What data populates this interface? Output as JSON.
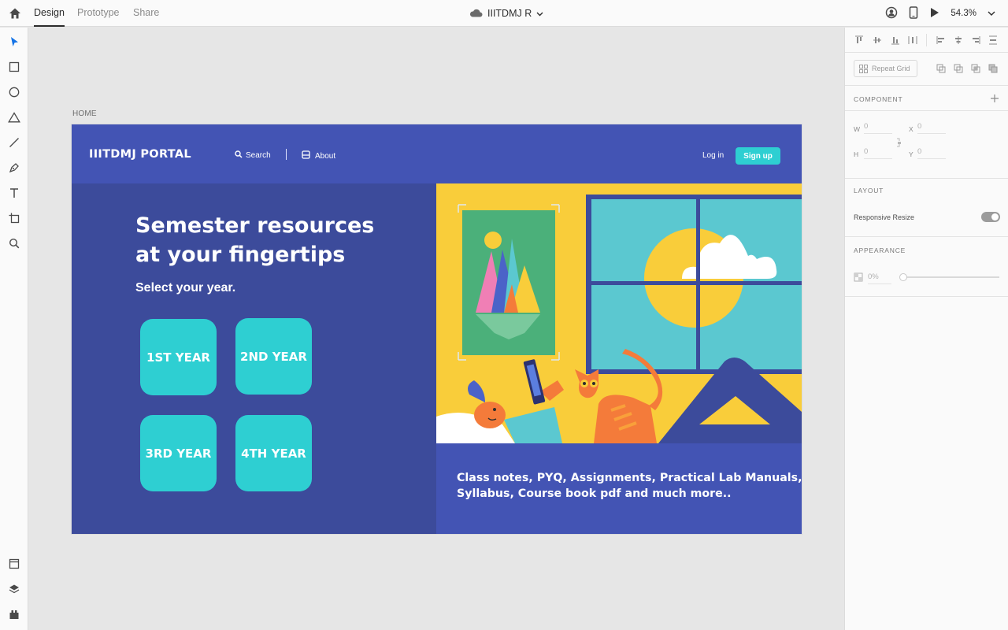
{
  "topbar": {
    "tabs": [
      "Design",
      "Prototype",
      "Share"
    ],
    "doc_title": "IIITDMJ R",
    "zoom": "54.3%"
  },
  "artboard": {
    "label": "HOME",
    "nav": {
      "brand": "IIITDMJ PORTAL",
      "search": "Search",
      "about": "About",
      "login": "Log in",
      "signup": "Sign up"
    },
    "hero": {
      "title_line1": "Semester resources",
      "title_line2": "at your fingertips",
      "subtitle": "Select your year."
    },
    "years": [
      "1ST YEAR",
      "2ND YEAR",
      "3RD YEAR",
      "4TH YEAR"
    ],
    "tagline_line1": "Class notes, PYQ, Assignments, Practical Lab Manuals,",
    "tagline_line2": "Syllabus, Course book pdf and much more.."
  },
  "panel": {
    "repeat_grid": "Repeat Grid",
    "component_label": "COMPONENT",
    "w_label": "W",
    "w_value": "0",
    "h_label": "H",
    "h_value": "0",
    "x_label": "X",
    "x_value": "0",
    "y_label": "Y",
    "y_value": "0",
    "layout_label": "LAYOUT",
    "responsive_resize": "Responsive Resize",
    "responsive_resize_on": true,
    "appearance_label": "APPEARANCE",
    "opacity": "0%"
  },
  "colors": {
    "nav_blue": "#4354b4",
    "hero_blue": "#3c4b9b",
    "cyan": "#2ecfd2",
    "illustration_yellow": "#f9cd3a",
    "accent_select": "#1473e6"
  },
  "icons": {
    "toolbar": [
      "select-icon",
      "rectangle-icon",
      "ellipse-icon",
      "polygon-icon",
      "line-icon",
      "pen-icon",
      "text-icon",
      "artboard-icon",
      "zoom-icon"
    ],
    "toolbar_bottom": [
      "assets-icon",
      "layers-icon",
      "plugins-icon"
    ]
  }
}
